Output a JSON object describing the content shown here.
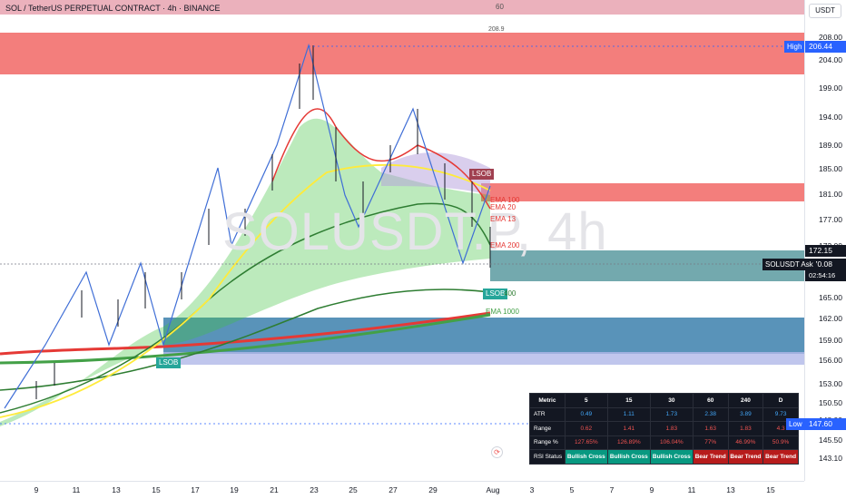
{
  "header": {
    "title": "SOL / TetherUS PERPETUAL CONTRACT · 4h · BINANCE"
  },
  "watermark": "SOLUSDT.P, 4h",
  "price_axis": {
    "currency": "USDT",
    "labels": [
      "208.00",
      "204.00",
      "199.00",
      "194.00",
      "189.00",
      "185.00",
      "181.00",
      "177.00",
      "173.00",
      "169.00",
      "165.00",
      "162.00",
      "159.00",
      "156.00",
      "153.00",
      "150.50",
      "148.00",
      "145.50",
      "143.10"
    ],
    "high_tag": {
      "label": "High",
      "value": "206.44"
    },
    "current_price": "172.15",
    "ask_tag": {
      "label": "SOLUSDT Ask",
      "value": "170.08",
      "countdown": "02:54:16"
    },
    "low_tag": {
      "label": "Low",
      "value": "147.60"
    }
  },
  "time_axis": {
    "labels": [
      "9",
      "11",
      "13",
      "15",
      "17",
      "19",
      "21",
      "23",
      "25",
      "27",
      "29",
      "Aug",
      "3",
      "5",
      "7",
      "9",
      "11",
      "13",
      "15"
    ]
  },
  "chart_labels": {
    "lsob_top": "LSOB",
    "lsob_bottom": "LSOB",
    "lsob_right": "LSOB",
    "ema_13": "EMA 13",
    "ema_20": "EMA 20",
    "ema_100": "EMA 100",
    "ema_200": "EMA 200",
    "ema_400": "400",
    "ema_1000": "EMA 1000",
    "fib_60": "60",
    "fib_2089": "208.9"
  },
  "metrics": {
    "headers": [
      "Metric",
      "5",
      "15",
      "30",
      "60",
      "240",
      "D"
    ],
    "atr": {
      "label": "ATR",
      "values": [
        "0.49",
        "1.11",
        "1.73",
        "2.38",
        "3.89",
        "9.73"
      ]
    },
    "range": {
      "label": "Range",
      "values": [
        "0.62",
        "1.41",
        "1.83",
        "1.63",
        "1.83",
        "4.3"
      ]
    },
    "range_pct": {
      "label": "Range %",
      "values": [
        "127.65%",
        "126.89%",
        "106.04%",
        "77%",
        "46.99%",
        "50.9%"
      ]
    },
    "rsi": {
      "label": "RSI Status",
      "values": [
        "Bullish Cross",
        "Bullish Cross",
        "Bullish Cross",
        "Bear Trend",
        "Bear Trend",
        "Bear Trend"
      ]
    }
  }
}
